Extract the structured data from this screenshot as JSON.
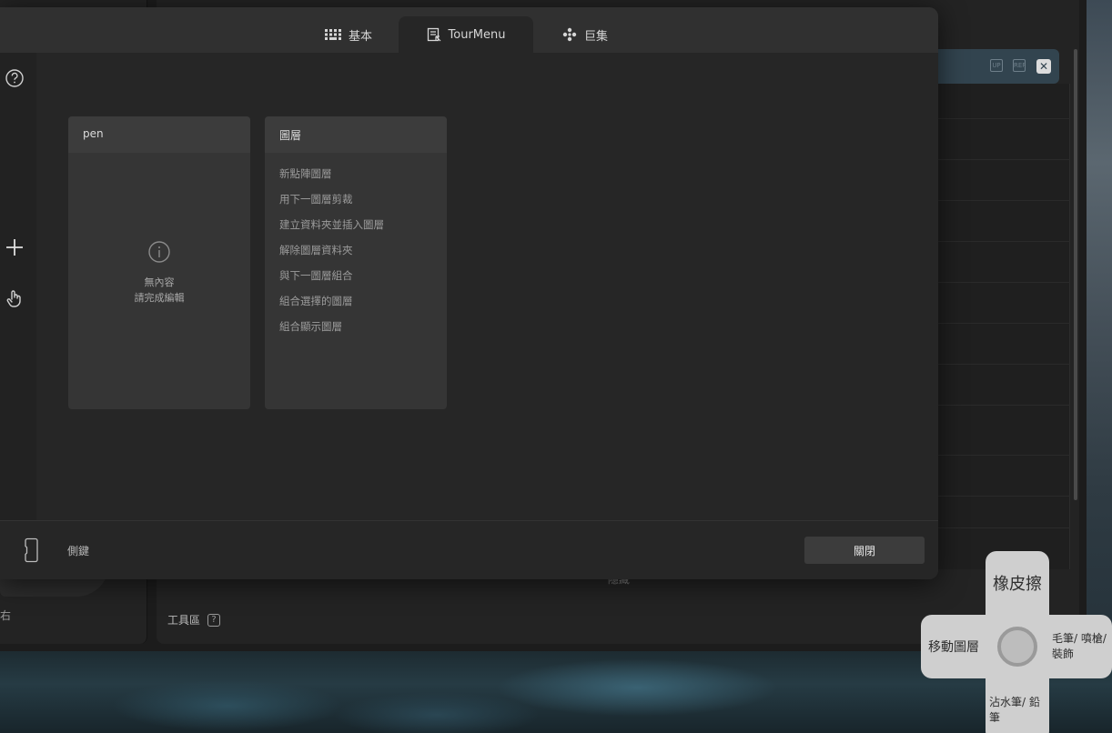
{
  "tabs": [
    {
      "label": "基本",
      "icon": "keyboard-icon"
    },
    {
      "label": "TourMenu",
      "icon": "tour-menu-icon",
      "active": true
    },
    {
      "label": "巨集",
      "icon": "macro-icon"
    }
  ],
  "rail": {
    "help": "?"
  },
  "cards": {
    "pen": {
      "title": "pen",
      "empty_line1": "無內容",
      "empty_line2": "請完成編輯"
    },
    "layer": {
      "title": "圖層",
      "items": [
        "新點陣圖層",
        "用下一圖層剪裁",
        "建立資料夾並插入圖層",
        "解除圖層資料夾",
        "與下一圖層組合",
        "組合選擇的圖層",
        "組合顯示圖層"
      ]
    }
  },
  "footer": {
    "side_key_label": "側鍵",
    "close_label": "關閉"
  },
  "background": {
    "hidden_label": "⌃ 隱藏",
    "tool_area_label": "工具區",
    "tool_area_help": "?",
    "left_text": "右",
    "badge1": "UP",
    "badge2": "REF",
    "close_glyph": "✕"
  },
  "wheel": {
    "top": "橡皮擦",
    "left": "移動圖層",
    "right": "毛筆/ 噴槍/ 裝飾",
    "bottom": "沾水筆/ 鉛筆"
  }
}
